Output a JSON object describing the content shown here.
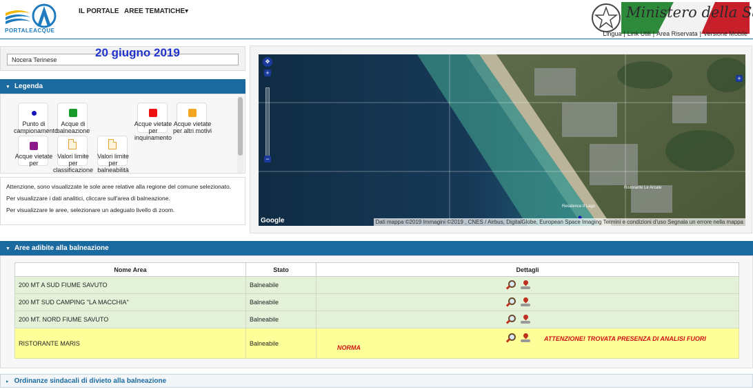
{
  "header": {
    "logo_text": "PORTALEACQUE",
    "nav": [
      "IL PORTALE",
      "AREE TEMATICHE"
    ],
    "ministry_title": "Ministero della Salute",
    "top_links": [
      "Lingua",
      "Link Utili",
      "Area Riservata",
      "Versione Mobile"
    ]
  },
  "search": {
    "value": "Nocera Terinese"
  },
  "date_overlay": "20 giugno 2019",
  "legend": {
    "title": "Legenda",
    "items": [
      {
        "label": "Punto di campionamento",
        "icon": "dot",
        "color": "#1515c0"
      },
      {
        "label": "Acque di balneazione",
        "icon": "square",
        "color": "#1a9a2a"
      },
      {
        "label": "Acque vietate per inquinamento",
        "icon": "square",
        "color": "#ee1111"
      },
      {
        "label": "Acque vietate per altri motivi",
        "icon": "square",
        "color": "#f5a623"
      },
      {
        "label": "Acque vietate per",
        "icon": "square",
        "color": "#8a1a8a"
      },
      {
        "label": "Valori limite per classificazione",
        "icon": "document-icon"
      },
      {
        "label": "Valori limite per balneabilità",
        "icon": "document-icon"
      }
    ]
  },
  "info": {
    "lines": [
      "Attenzione, sono visualizzate le sole aree relative alla regione del comune selezionato.",
      "Per visualizzare i dati analitici, cliccare sull'area di balneazione.",
      "Per visualizzare le aree, selezionare un adeguato livello di zoom."
    ]
  },
  "map": {
    "google_label": "Google",
    "attribution": "Dati mappa ©2019 Immagini ©2019 , CNES / Airbus, DigitalGlobe, European Space Imaging   Termini e condizioni d'uso   Segnala un errore nella mappa",
    "place_labels": [
      "Ristorante Le Arcate",
      "Residence Il Lago"
    ]
  },
  "aree": {
    "title": "Aree adibite alla balneazione",
    "columns": [
      "Nome Area",
      "Stato",
      "Dettagli"
    ],
    "rows": [
      {
        "name": "200 MT A SUD FIUME SAVUTO",
        "stato": "Balneabile",
        "warn": false
      },
      {
        "name": "200 MT SUD CAMPING \"LA MACCHIA\"",
        "stato": "Balneabile",
        "warn": false
      },
      {
        "name": "200 MT. NORD FIUME SAVUTO",
        "stato": "Balneabile",
        "warn": false
      },
      {
        "name": "RISTORANTE MARIS",
        "stato": "Balneabile",
        "warn": true
      }
    ],
    "warning_line1": "ATTENZIONE! TROVATA PRESENZA DI ANALISI FUORI",
    "warning_line2": "NORMA"
  },
  "ordinanze": {
    "title": "Ordinanze sindacali di divieto alla balneazione"
  }
}
